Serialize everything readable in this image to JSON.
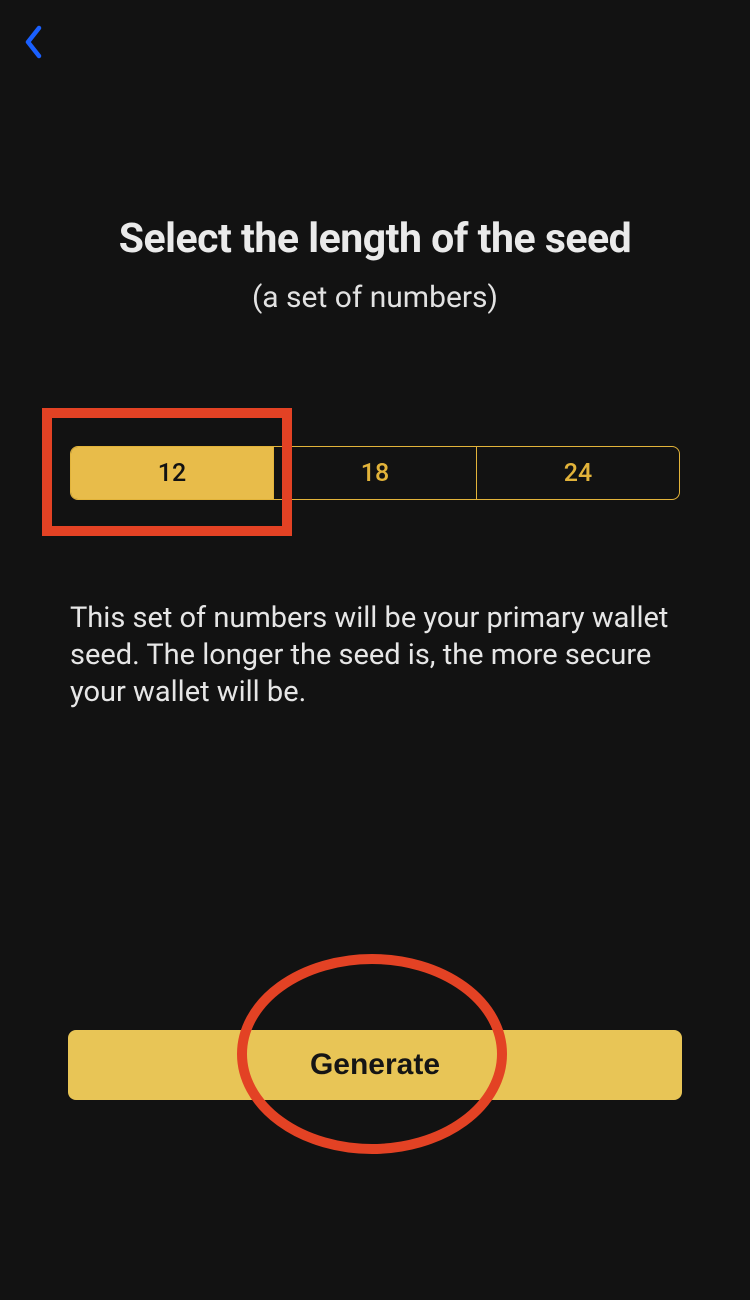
{
  "nav": {
    "back_icon": "chevron-left"
  },
  "header": {
    "title": "Select the length of the seed",
    "subtitle": "(a set of numbers)"
  },
  "segmented": {
    "options": [
      {
        "label": "12",
        "selected": true
      },
      {
        "label": "18",
        "selected": false
      },
      {
        "label": "24",
        "selected": false
      }
    ]
  },
  "description": "This set of numbers will be your primary wallet seed. The longer the seed is, the more secure your wallet will be.",
  "generate_button": {
    "label": "Generate"
  },
  "colors": {
    "background": "#121212",
    "accent": "#e8bc4a",
    "button": "#e8c556",
    "highlight": "#e34224",
    "blue": "#1a60ff",
    "text": "#e8e8e8"
  }
}
